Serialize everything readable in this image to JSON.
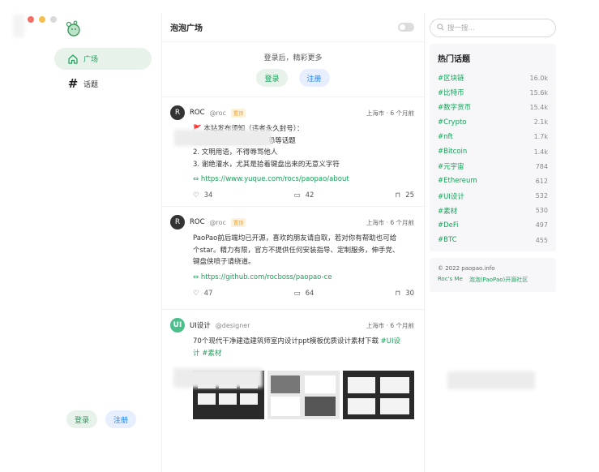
{
  "app": {
    "colors": {
      "accent": "#18a058",
      "accent_bg": "#e7f3ea",
      "blue": "#2080f0",
      "blue_bg": "#e7efff"
    }
  },
  "nav": {
    "items": [
      {
        "label": "广场",
        "icon": "home-icon",
        "active": true
      },
      {
        "label": "话题",
        "icon": "hash-icon",
        "active": false
      }
    ],
    "login_label": "登录",
    "register_label": "注册"
  },
  "header": {
    "title": "泡泡广场"
  },
  "login_box": {
    "tip": "登录后，精彩更多",
    "login_label": "登录",
    "register_label": "注册"
  },
  "posts": [
    {
      "author": "ROC",
      "handle": "@roc",
      "badge": "置顶",
      "meta": "上海市 · 6 个月前",
      "lines": [
        "🚩 本站发布须知（违者永久封号）：",
        "恐等话题",
        "2. 文明用语，不得辱骂他人",
        "3. 谢绝灌水，尤其是拾着键盘出来的无意义字符"
      ],
      "link": "https://www.yuque.com/rocs/paopao/about",
      "likes": "34",
      "comments": "42",
      "collects": "25"
    },
    {
      "author": "ROC",
      "handle": "@roc",
      "badge": "置顶",
      "meta": "上海市 · 6 个月前",
      "lines": [
        "PaoPao前后端均已开源，喜欢的朋友请自取，若对你有帮助也可给",
        "个star。精力有限，官方不提供任何安装指导、定制服务，伸手党、",
        "键盘侠喷子请绕道。"
      ],
      "link": "https://github.com/rocboss/paopao-ce",
      "likes": "47",
      "comments": "64",
      "collects": "30"
    },
    {
      "author": "UI设计",
      "handle": "@designer",
      "meta": "上海市 · 6 个月前",
      "text": "70个现代干净建造建筑师室内设计ppt模板优质设计素材下载",
      "tag1": "#UI设",
      "tag2": "计 #素材"
    }
  ],
  "search": {
    "placeholder": "搜一搜..."
  },
  "topics": {
    "title": "热门话题",
    "items": [
      {
        "name": "#区块链",
        "count": "16.0k"
      },
      {
        "name": "#比特币",
        "count": "15.6k"
      },
      {
        "name": "#数字货币",
        "count": "15.4k"
      },
      {
        "name": "#Crypto",
        "count": "2.1k"
      },
      {
        "name": "#nft",
        "count": "1.7k"
      },
      {
        "name": "#Bitcoin",
        "count": "1.4k"
      },
      {
        "name": "#元宇宙",
        "count": "784"
      },
      {
        "name": "#Ethereum",
        "count": "612"
      },
      {
        "name": "#UI设计",
        "count": "532"
      },
      {
        "name": "#素材",
        "count": "530"
      },
      {
        "name": "#DeFi",
        "count": "497"
      },
      {
        "name": "#BTC",
        "count": "455"
      }
    ]
  },
  "footer": {
    "copyright": "© 2022 paopao.info",
    "links": [
      "Roc's Me",
      "泡泡(PaoPao)开源社区"
    ]
  }
}
